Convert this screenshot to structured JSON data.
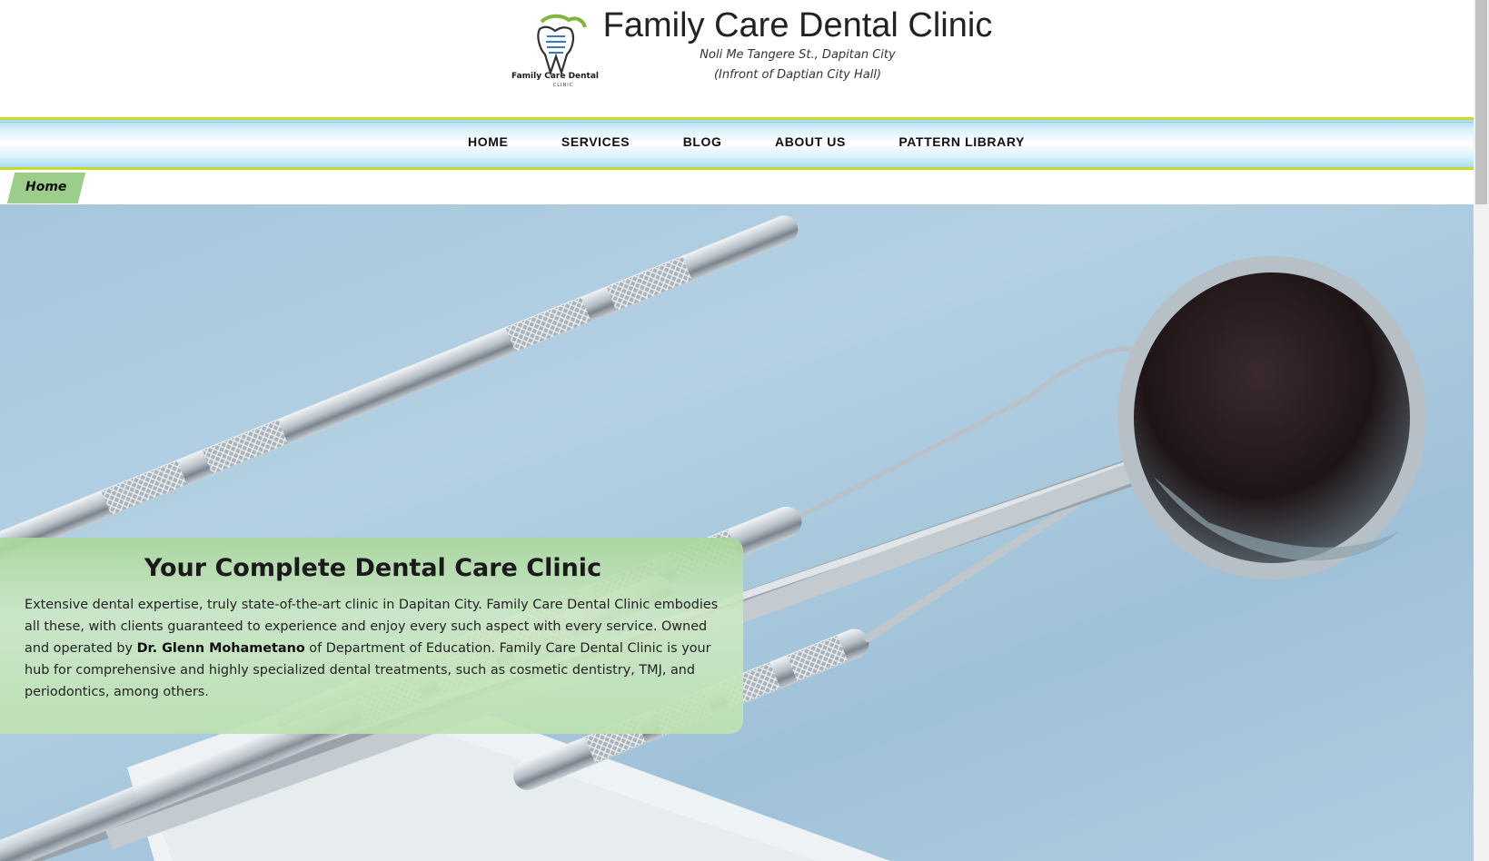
{
  "header": {
    "logo_text": "Family Care Dental",
    "logo_subtext": "CLINIC",
    "title": "Family Care Dental Clinic",
    "address_line1": "Noli Me Tangere St., Dapitan City",
    "address_line2": "(Infront of Daptian City Hall)"
  },
  "nav": {
    "items": [
      {
        "label": "HOME"
      },
      {
        "label": "SERVICES"
      },
      {
        "label": "BLOG"
      },
      {
        "label": "ABOUT US"
      },
      {
        "label": "PATTERN LIBRARY"
      }
    ]
  },
  "breadcrumb": {
    "label": "Home"
  },
  "hero": {
    "image": "dental-instruments-photo",
    "card": {
      "title": "Your Complete Dental Care Clinic",
      "text_before": "Extensive dental expertise, truly state-of-the-art clinic in Dapitan City. Family Care Dental Clinic embodies all these, with clients guaranteed to experience and enjoy every such aspect with every service. Owned and operated by ",
      "bold_name": "Dr. Glenn Mohametano",
      "text_after": " of Department of Education. Family Care Dental Clinic is your hub for comprehensive and highly specialized dental treatments, such as cosmetic dentistry, TMJ, and periodontics, among others."
    }
  },
  "colors": {
    "nav_border": "#c9d92a",
    "nav_blue": "#a9dcf5",
    "breadcrumb_green": "#9dcd8a",
    "card_green": "#aad79b"
  }
}
